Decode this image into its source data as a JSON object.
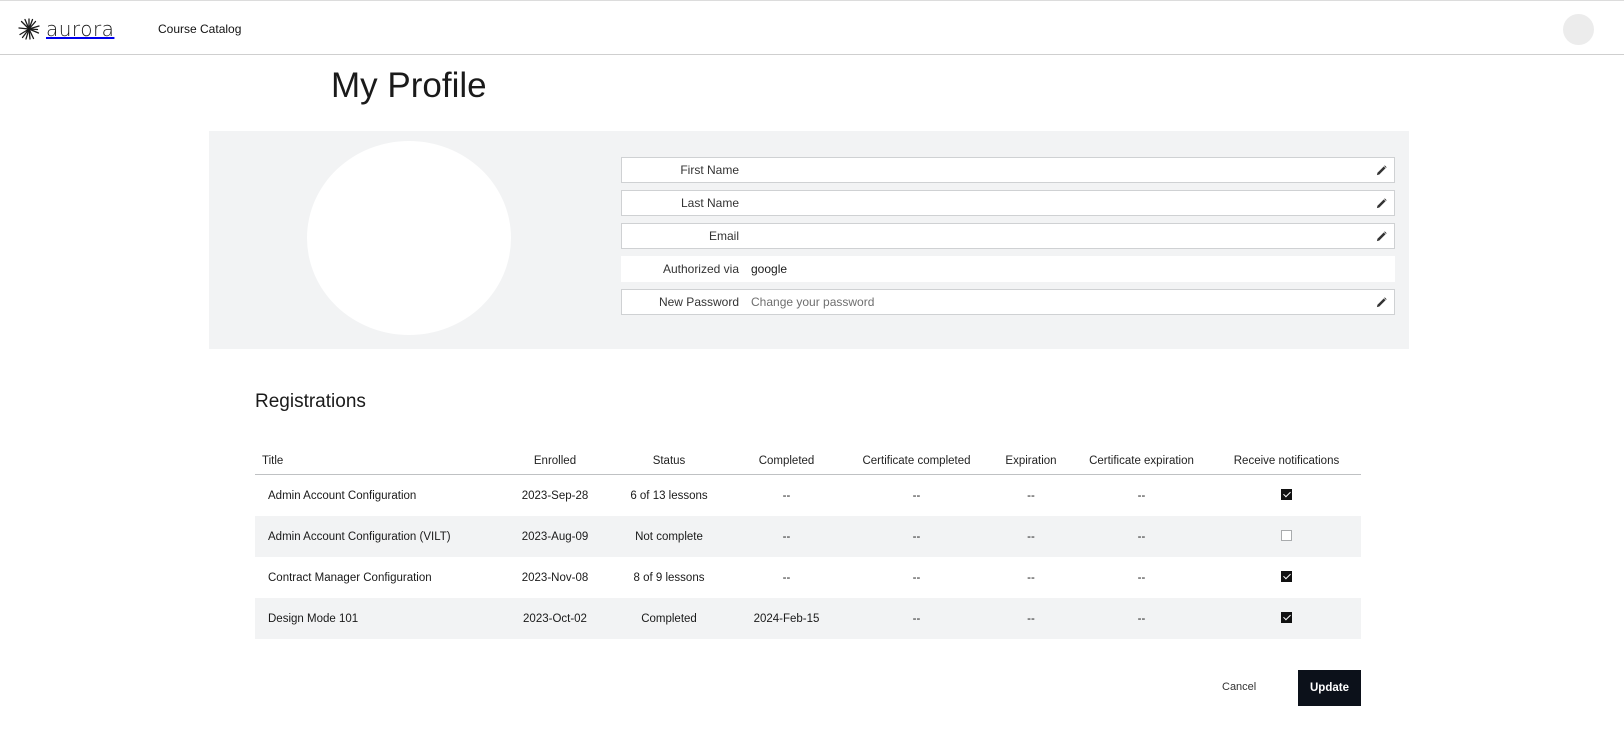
{
  "app": {
    "brand": "aurora"
  },
  "nav": {
    "course_catalog": "Course Catalog"
  },
  "page": {
    "title": "My Profile"
  },
  "profile": {
    "first_name": {
      "label": "First Name",
      "value": ""
    },
    "last_name": {
      "label": "Last Name",
      "value": ""
    },
    "email": {
      "label": "Email",
      "value": ""
    },
    "authorized_via": {
      "label": "Authorized via",
      "value": "google"
    },
    "new_password": {
      "label": "New Password",
      "placeholder": "Change your password"
    }
  },
  "registrations": {
    "title": "Registrations",
    "columns": [
      "Title",
      "Enrolled",
      "Status",
      "Completed",
      "Certificate completed",
      "Expiration",
      "Certificate expiration",
      "Receive notifications"
    ],
    "rows": [
      {
        "title": "Admin Account Configuration",
        "enrolled": "2023-Sep-28",
        "status": "6 of 13 lessons",
        "completed": "--",
        "cert_completed": "--",
        "expiration": "--",
        "cert_expiration": "--",
        "notify": true
      },
      {
        "title": "Admin Account Configuration (VILT)",
        "enrolled": "2023-Aug-09",
        "status": "Not complete",
        "completed": "--",
        "cert_completed": "--",
        "expiration": "--",
        "cert_expiration": "--",
        "notify": false
      },
      {
        "title": "Contract Manager Configuration",
        "enrolled": "2023-Nov-08",
        "status": "8 of 9 lessons",
        "completed": "--",
        "cert_completed": "--",
        "expiration": "--",
        "cert_expiration": "--",
        "notify": true
      },
      {
        "title": "Design Mode 101",
        "enrolled": "2023-Oct-02",
        "status": "Completed",
        "completed": "2024-Feb-15",
        "cert_completed": "--",
        "expiration": "--",
        "cert_expiration": "--",
        "notify": true
      }
    ]
  },
  "actions": {
    "cancel": "Cancel",
    "update": "Update"
  },
  "icons": {
    "logo": "aurora-burst-icon",
    "edit": "pencil-icon"
  }
}
